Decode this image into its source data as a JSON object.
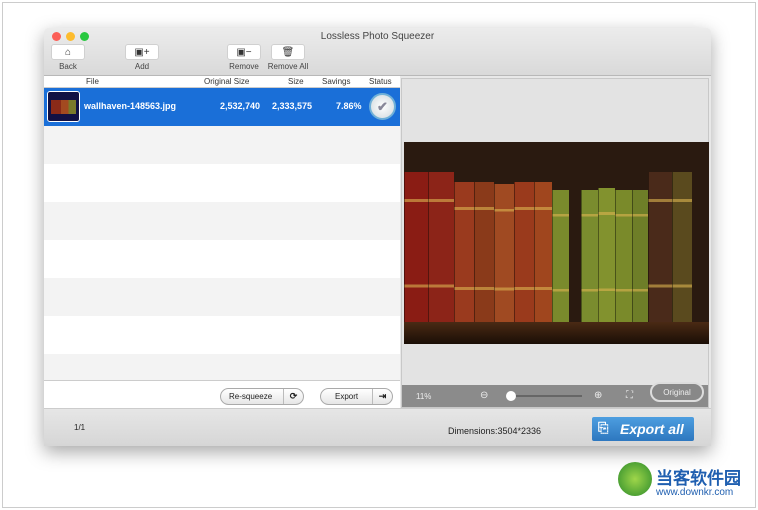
{
  "window": {
    "title": "Lossless Photo Squeezer"
  },
  "toolbar": {
    "back": "Back",
    "add": "Add",
    "remove": "Remove",
    "remove_all": "Remove All"
  },
  "table": {
    "headers": {
      "file": "File",
      "original_size": "Original Size",
      "size": "Size",
      "savings": "Savings",
      "status": "Status"
    },
    "rows": [
      {
        "file": "wallhaven-148563.jpg",
        "original_size": "2,532,740",
        "size": "2,333,575",
        "savings": "7.86%",
        "status": "done",
        "selected": true
      }
    ]
  },
  "actions": {
    "resqueeze": "Re-squeeze",
    "export": "Export"
  },
  "preview": {
    "zoom": "11%",
    "slider_value": 0,
    "original_button": "Original"
  },
  "footer": {
    "count": "1/1",
    "dimensions": "Dimensions:3504*2336",
    "export_all": "Export all"
  },
  "watermark": {
    "name": "当客软件园",
    "url": "www.downkr.com"
  },
  "colors": {
    "selection": "#1a6fd8",
    "export_all": "#3a8ad0"
  }
}
